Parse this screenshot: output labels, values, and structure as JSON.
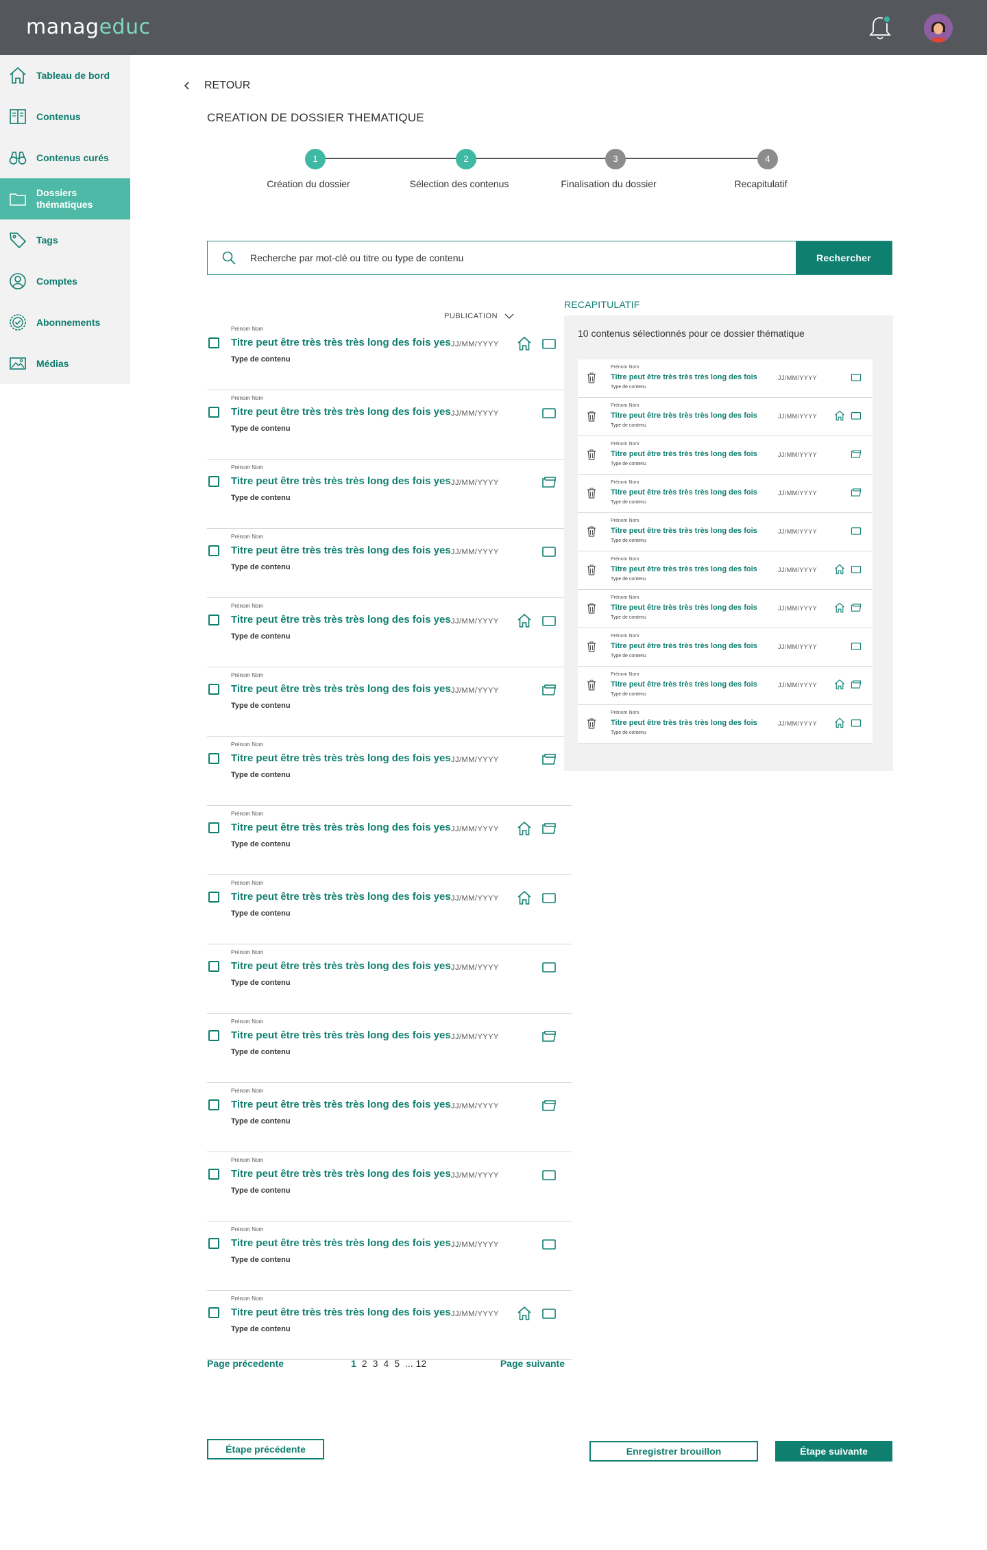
{
  "header": {
    "logo_part1": "manag",
    "logo_part2": "educ",
    "icons": [
      "bell-icon",
      "avatar"
    ]
  },
  "sidebar": {
    "items": [
      {
        "label": "Tableau de bord",
        "icon": "home-icon",
        "active": false
      },
      {
        "label": "Contenus",
        "icon": "book-icon",
        "active": false
      },
      {
        "label": "Contenus curés",
        "icon": "binoculars-icon",
        "active": false
      },
      {
        "label": "Dossiers thématiques",
        "icon": "folder-icon",
        "active": true
      },
      {
        "label": "Tags",
        "icon": "tag-icon",
        "active": false
      },
      {
        "label": "Comptes",
        "icon": "user-icon",
        "active": false
      },
      {
        "label": "Abonnements",
        "icon": "badge-icon",
        "active": false
      },
      {
        "label": "Médias",
        "icon": "image-icon",
        "active": false
      }
    ]
  },
  "main": {
    "back_label": "RETOUR",
    "title": "CREATION DE DOSSIER THEMATIQUE",
    "steps": [
      {
        "num": "1",
        "label": "Création du dossier",
        "state": "done"
      },
      {
        "num": "2",
        "label": "Sélection des contenus",
        "state": "current"
      },
      {
        "num": "3",
        "label": "Finalisation du dossier",
        "state": "todo"
      },
      {
        "num": "4",
        "label": "Recapitulatif",
        "state": "todo"
      }
    ],
    "search": {
      "placeholder": "Recherche par mot-clé ou titre ou type de contenu",
      "button": "Rechercher"
    },
    "sort_label": "PUBLICATION",
    "rows": [
      {
        "author": "Prénom Nom",
        "title": "Titre peut être très très très long des fois yes",
        "type": "Type de contenu",
        "date": "JJ/MM/YYYY",
        "home": true,
        "folder": "closed"
      },
      {
        "author": "Prénom Nom",
        "title": "Titre peut être très très très long des fois yes",
        "type": "Type de contenu",
        "date": "JJ/MM/YYYY",
        "home": false,
        "folder": "closed"
      },
      {
        "author": "Prénom Nom",
        "title": "Titre peut être très très très long des fois yes",
        "type": "Type de contenu",
        "date": "JJ/MM/YYYY",
        "home": false,
        "folder": "open"
      },
      {
        "author": "Prénom Nom",
        "title": "Titre peut être très très très long des fois yes",
        "type": "Type de contenu",
        "date": "JJ/MM/YYYY",
        "home": false,
        "folder": "closed"
      },
      {
        "author": "Prénom Nom",
        "title": "Titre peut être très très très long des fois yes",
        "type": "Type de contenu",
        "date": "JJ/MM/YYYY",
        "home": true,
        "folder": "closed"
      },
      {
        "author": "Prénom Nom",
        "title": "Titre peut être très très très long des fois yes",
        "type": "Type de contenu",
        "date": "JJ/MM/YYYY",
        "home": false,
        "folder": "open"
      },
      {
        "author": "Prénom Nom",
        "title": "Titre peut être très très très long des fois yes",
        "type": "Type de contenu",
        "date": "JJ/MM/YYYY",
        "home": false,
        "folder": "open"
      },
      {
        "author": "Prénom Nom",
        "title": "Titre peut être très très très long des fois yes",
        "type": "Type de contenu",
        "date": "JJ/MM/YYYY",
        "home": true,
        "folder": "open"
      },
      {
        "author": "Prénom Nom",
        "title": "Titre peut être très très très long des fois yes",
        "type": "Type de contenu",
        "date": "JJ/MM/YYYY",
        "home": true,
        "folder": "closed"
      },
      {
        "author": "Prénom Nom",
        "title": "Titre peut être très très très long des fois yes",
        "type": "Type de contenu",
        "date": "JJ/MM/YYYY",
        "home": false,
        "folder": "closed"
      },
      {
        "author": "Prénom Nom",
        "title": "Titre peut être très très très long des fois yes",
        "type": "Type de contenu",
        "date": "JJ/MM/YYYY",
        "home": false,
        "folder": "open"
      },
      {
        "author": "Prénom Nom",
        "title": "Titre peut être très très très long des fois yes",
        "type": "Type de contenu",
        "date": "JJ/MM/YYYY",
        "home": false,
        "folder": "open"
      },
      {
        "author": "Prénom Nom",
        "title": "Titre peut être très très très long des fois yes",
        "type": "Type de contenu",
        "date": "JJ/MM/YYYY",
        "home": false,
        "folder": "closed"
      },
      {
        "author": "Prénom Nom",
        "title": "Titre peut être très très très long des fois yes",
        "type": "Type de contenu",
        "date": "JJ/MM/YYYY",
        "home": false,
        "folder": "closed"
      },
      {
        "author": "Prénom Nom",
        "title": "Titre peut être très très très long des fois yes",
        "type": "Type de contenu",
        "date": "JJ/MM/YYYY",
        "home": true,
        "folder": "closed"
      }
    ],
    "pager": {
      "prev": "Page précedente",
      "next": "Page suivante",
      "pages": [
        "1",
        "2",
        "3",
        "4",
        "5",
        "... 12"
      ],
      "current": "1"
    }
  },
  "recap": {
    "title": "RECAPITULATIF",
    "count_text": "10 contenus sélectionnés pour ce dossier thématique",
    "rows": [
      {
        "author": "Prénom Nom",
        "title": "Titre peut être très très très long des fois",
        "type": "Type de contenu",
        "date": "JJ/MM/YYYY",
        "home": false,
        "folder": "closed"
      },
      {
        "author": "Prénom Nom",
        "title": "Titre peut être très très très long des fois",
        "type": "Type de contenu",
        "date": "JJ/MM/YYYY",
        "home": true,
        "folder": "closed"
      },
      {
        "author": "Prénom Nom",
        "title": "Titre peut être très très très long des fois",
        "type": "Type de contenu",
        "date": "JJ/MM/YYYY",
        "home": false,
        "folder": "open"
      },
      {
        "author": "Prénom Nom",
        "title": "Titre peut être très très très long des fois",
        "type": "Type de contenu",
        "date": "JJ/MM/YYYY",
        "home": false,
        "folder": "open"
      },
      {
        "author": "Prénom Nom",
        "title": "Titre peut être très très très long des fois",
        "type": "Type de contenu",
        "date": "JJ/MM/YYYY",
        "home": false,
        "folder": "closed"
      },
      {
        "author": "Prénom Nom",
        "title": "Titre peut être très très très long des fois",
        "type": "Type de contenu",
        "date": "JJ/MM/YYYY",
        "home": true,
        "folder": "closed"
      },
      {
        "author": "Prénom Nom",
        "title": "Titre peut être très très très long des fois",
        "type": "Type de contenu",
        "date": "JJ/MM/YYYY",
        "home": true,
        "folder": "open"
      },
      {
        "author": "Prénom Nom",
        "title": "Titre peut être très très très long des fois",
        "type": "Type de contenu",
        "date": "JJ/MM/YYYY",
        "home": false,
        "folder": "closed"
      },
      {
        "author": "Prénom Nom",
        "title": "Titre peut être très très très long des fois",
        "type": "Type de contenu",
        "date": "JJ/MM/YYYY",
        "home": true,
        "folder": "open"
      },
      {
        "author": "Prénom Nom",
        "title": "Titre peut être très très très long des fois",
        "type": "Type de contenu",
        "date": "JJ/MM/YYYY",
        "home": true,
        "folder": "closed"
      }
    ]
  },
  "footer": {
    "prev_step": "Étape précédente",
    "save_draft": "Enregistrer brouillon",
    "next_step": "Étape suivante"
  },
  "colors": {
    "accent": "#0f7f70",
    "accent_light": "#4db9a6",
    "header_bg": "#54575b",
    "sidebar_bg": "#f2f2f2"
  }
}
